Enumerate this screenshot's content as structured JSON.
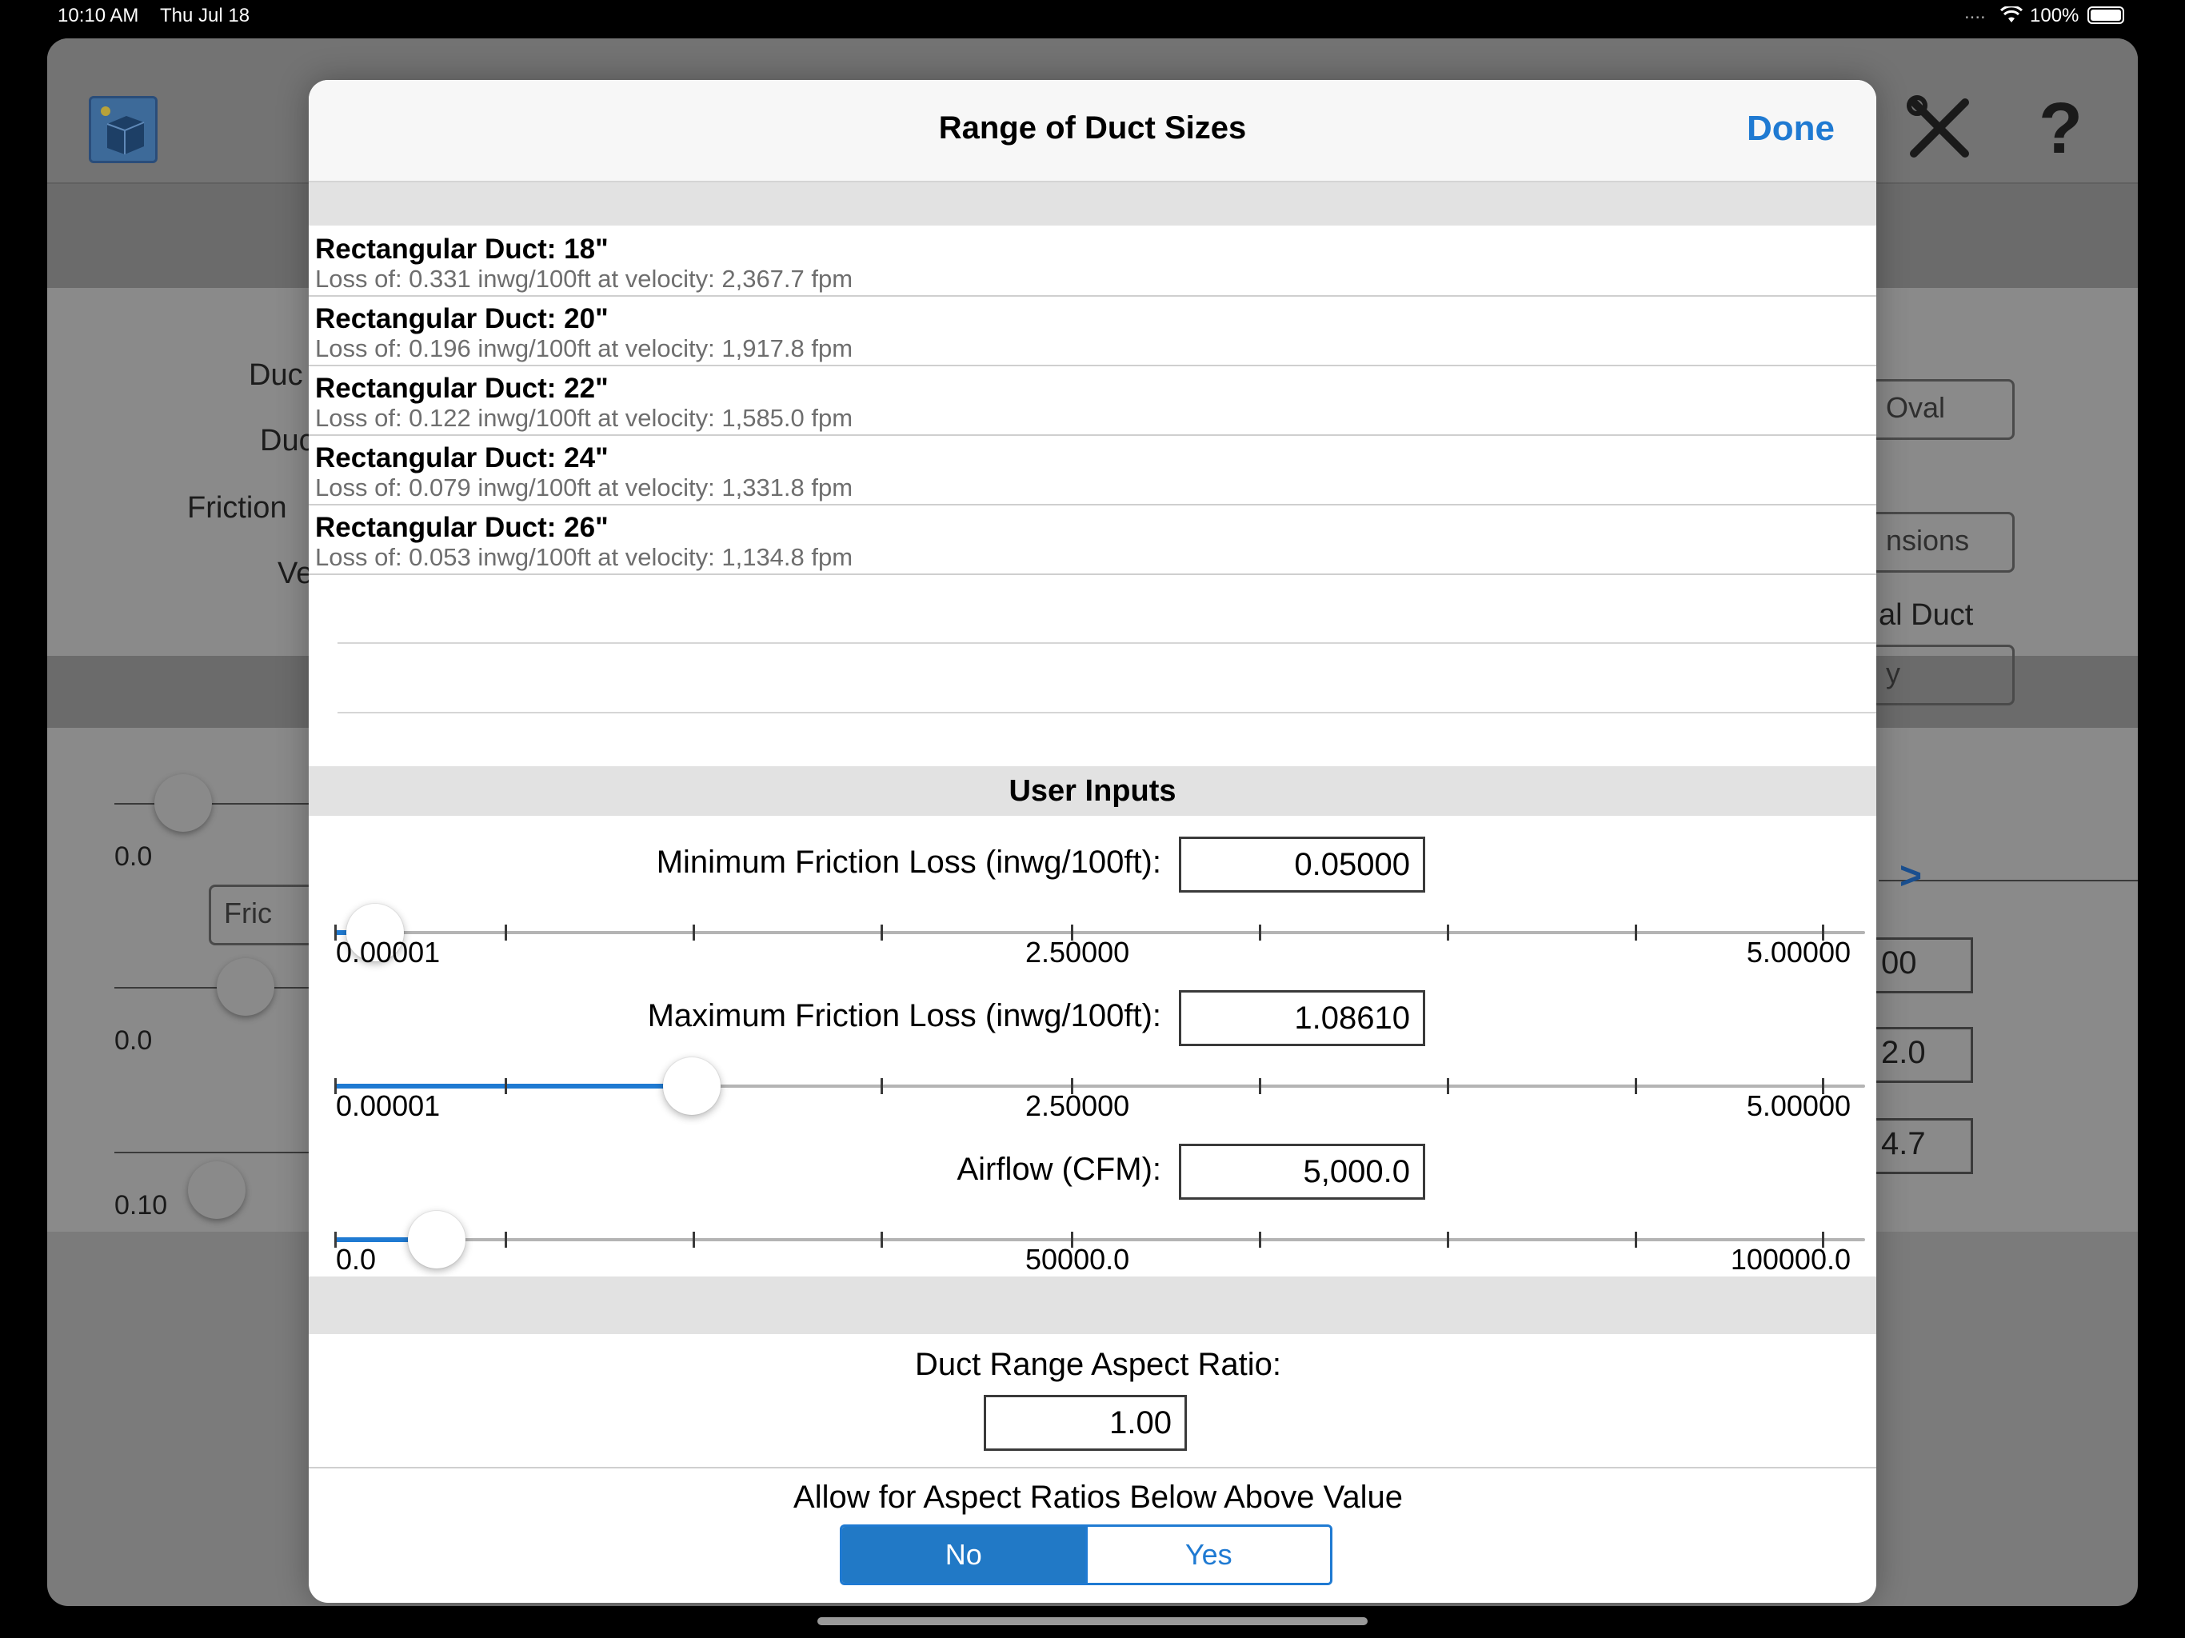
{
  "status_bar": {
    "time": "10:10 AM",
    "date": "Thu Jul 18",
    "signal": "....",
    "battery": "100%"
  },
  "background": {
    "labels": [
      "Duc",
      "Duc",
      "Friction",
      "Ve"
    ],
    "buttons": [
      "Oval",
      "nsions",
      "y"
    ],
    "section_label": "al Duct",
    "fric_button": "Fric",
    "slider_labels": [
      "0.0",
      "0.0",
      "0.10"
    ],
    "values": [
      "00",
      "2.0",
      "4.7"
    ]
  },
  "modal": {
    "title": "Range of Duct Sizes",
    "done_label": "Done",
    "results": [
      {
        "title": "Rectangular Duct: 18\"",
        "detail": "Loss of: 0.331 inwg/100ft at velocity: 2,367.7 fpm"
      },
      {
        "title": "Rectangular Duct: 20\"",
        "detail": "Loss of: 0.196 inwg/100ft at velocity: 1,917.8 fpm"
      },
      {
        "title": "Rectangular Duct: 22\"",
        "detail": "Loss of: 0.122 inwg/100ft at velocity: 1,585.0 fpm"
      },
      {
        "title": "Rectangular Duct: 24\"",
        "detail": "Loss of: 0.079 inwg/100ft at velocity: 1,331.8 fpm"
      },
      {
        "title": "Rectangular Duct: 26\"",
        "detail": "Loss of: 0.053 inwg/100ft at velocity: 1,134.8 fpm"
      }
    ],
    "user_inputs_header": "User Inputs",
    "min_friction": {
      "label": "Minimum Friction Loss (inwg/100ft):",
      "value": "0.05000",
      "fraction": 0.01,
      "scale": [
        "0.00001",
        "2.50000",
        "5.00000"
      ]
    },
    "max_friction": {
      "label": "Maximum Friction Loss (inwg/100ft):",
      "value": "1.08610",
      "fraction": 0.217,
      "scale": [
        "0.00001",
        "2.50000",
        "5.00000"
      ]
    },
    "airflow": {
      "label": "Airflow (CFM):",
      "value": "5,000.0",
      "fraction": 0.05,
      "scale": [
        "0.0",
        "50000.0",
        "100000.0"
      ]
    },
    "aspect_ratio": {
      "label": "Duct Range Aspect Ratio:",
      "value": "1.00"
    },
    "allow_below": {
      "label": "Allow for Aspect Ratios Below Above Value",
      "options": [
        "No",
        "Yes"
      ],
      "selected": "No"
    }
  },
  "colors": {
    "accent": "#1f7ad2",
    "band": "#e2e2e2"
  }
}
